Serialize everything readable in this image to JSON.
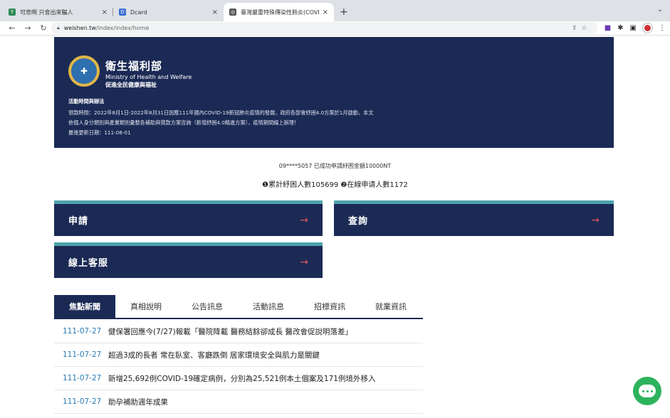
{
  "browser": {
    "tabs": [
      {
        "title": "可悲啊 只會出來騙人",
        "favicon_color": "#2e8b57"
      },
      {
        "title": "Dcard",
        "favicon_color": "#3b6fd1"
      },
      {
        "title": "臺灣嚴重特殊傳染性肺炎(COVID",
        "favicon_color": "#555555"
      }
    ],
    "new_tab": "+",
    "close": "×",
    "url_host": "weishen.tw",
    "url_path": "/index/index/home"
  },
  "banner": {
    "org_zh": "衛生福利部",
    "org_en": "Ministry of Health and Welfare",
    "slogan": "促進全民健康與福祉",
    "heading": "活動時間與辦法",
    "line1": "領款時間：2022年8月1日-2022年8月31日因應111年國內COVID-19新冠肺炎疫情的發展，政府各部會紓困4.0方案於1月啟動，本文",
    "line2": "依個人身分類別與產業類別彙整各補助與貸款方案咨詢（新增紓困4.0精進方案），疫情期間線上辦理！",
    "line3": "最後更新日期：111-08-01"
  },
  "ticker": "09****5057 已成功申請紓困金額10000NT",
  "stats": "❶累計紓困人數105699 ❷在線申请人數1172",
  "cards": {
    "apply": "申請",
    "query": "查詢",
    "service": "線上客服",
    "arrow": "→"
  },
  "news_tabs": [
    "焦點新聞",
    "真相說明",
    "公告訊息",
    "活動訊息",
    "招標資訊",
    "就業資訊"
  ],
  "news": [
    {
      "date": "111-07-27",
      "title": "健保署回應今(7/27)報載「醫院降載 醫務結餘卻成長 醫改會促說明落差」"
    },
    {
      "date": "111-07-27",
      "title": "超過3成的長者 常在臥室、客廳跌倒 居家環境安全與肌力是關鍵"
    },
    {
      "date": "111-07-27",
      "title": "新增25,692例COVID-19確定病例，分別為25,521例本土個案及171例境外移入"
    },
    {
      "date": "111-07-27",
      "title": "助孕補助週年成果"
    }
  ],
  "colors": {
    "navy": "#1b2a55",
    "teal": "#4da3ac",
    "accent": "#e2545b",
    "chat": "#2db35d"
  }
}
